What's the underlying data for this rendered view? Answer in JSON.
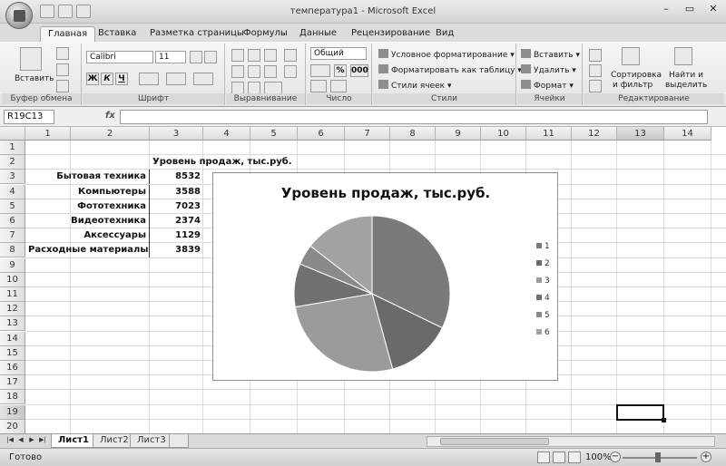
{
  "window": {
    "title": "температура1 - Microsoft Excel",
    "controls": [
      "–",
      "▭",
      "✕"
    ]
  },
  "tabs": [
    {
      "label": "Главная",
      "active": true
    },
    {
      "label": "Вставка"
    },
    {
      "label": "Разметка страницы"
    },
    {
      "label": "Формулы"
    },
    {
      "label": "Данные"
    },
    {
      "label": "Рецензирование"
    },
    {
      "label": "Вид"
    }
  ],
  "ribbon": {
    "clipboard": {
      "label": "Буфер обмена",
      "paste": "Вставить"
    },
    "font": {
      "label": "Шрифт",
      "name": "Calibri",
      "size": "11",
      "bold": "Ж",
      "italic": "К",
      "underline": "Ч"
    },
    "alignment": {
      "label": "Выравнивание"
    },
    "number": {
      "label": "Число",
      "format": "Общий",
      "percent": "%",
      "thousands": "000"
    },
    "styles": {
      "label": "Стили",
      "conditional": "Условное форматирование",
      "as_table": "Форматировать как таблицу",
      "cell_styles": "Стили ячеек"
    },
    "cells": {
      "label": "Ячейки",
      "insert": "Вставить",
      "delete": "Удалить",
      "format": "Формат"
    },
    "editing": {
      "label": "Редактирование",
      "sort1": "Сортировка",
      "sort2": "и фильтр",
      "find1": "Найти и",
      "find2": "выделить"
    }
  },
  "formula_bar": {
    "name_box": "R19C13",
    "fx": "fx",
    "value": ""
  },
  "columns": [
    "1",
    "2",
    "3",
    "4",
    "5",
    "6",
    "7",
    "8",
    "9",
    "10",
    "11",
    "12",
    "13",
    "14"
  ],
  "rows": [
    "1",
    "2",
    "3",
    "4",
    "5",
    "6",
    "7",
    "8",
    "9",
    "10",
    "11",
    "12",
    "13",
    "14",
    "15",
    "16",
    "17",
    "18",
    "19",
    "20"
  ],
  "table": {
    "header": "Уровень продаж, тыс.руб.",
    "items": [
      {
        "name": "Бытовая техника",
        "value": "8532"
      },
      {
        "name": "Компьютеры",
        "value": "3588"
      },
      {
        "name": "Фототехника",
        "value": "7023"
      },
      {
        "name": "Видеотехника",
        "value": "2374"
      },
      {
        "name": "Аксессуары",
        "value": "1129"
      },
      {
        "name": "Расходные материалы",
        "value": "3839"
      }
    ]
  },
  "chart_data": {
    "type": "pie",
    "title": "Уровень продаж, тыс.руб.",
    "categories": [
      "1",
      "2",
      "3",
      "4",
      "5",
      "6"
    ],
    "values": [
      8532,
      3588,
      7023,
      2374,
      1129,
      3839
    ],
    "colors": [
      "#7a7a7a",
      "#6a6a6a",
      "#9b9b9b",
      "#707070",
      "#8a8a8a",
      "#a2a2a2"
    ],
    "legend": "right"
  },
  "sheets": [
    {
      "label": "Лист1",
      "active": true
    },
    {
      "label": "Лист2"
    },
    {
      "label": "Лист3"
    }
  ],
  "status": {
    "text": "Готово",
    "zoom": "100%"
  }
}
